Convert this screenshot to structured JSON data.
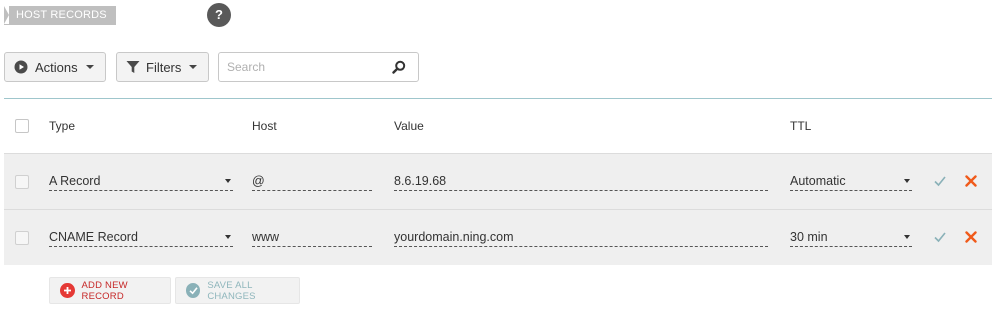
{
  "section_title": "HOST RECORDS",
  "help_label": "?",
  "toolbar": {
    "actions_label": "Actions",
    "filters_label": "Filters",
    "search_placeholder": "Search"
  },
  "table": {
    "headers": {
      "type": "Type",
      "host": "Host",
      "value": "Value",
      "ttl": "TTL"
    },
    "rows": [
      {
        "type": "A Record",
        "host": "@",
        "value": "8.6.19.68",
        "ttl": "Automatic"
      },
      {
        "type": "CNAME Record",
        "host": "www",
        "value": "yourdomain.ning.com",
        "ttl": "30 min"
      }
    ]
  },
  "buttons": {
    "add_label": "ADD NEW RECORD",
    "save_label": "SAVE ALL CHANGES"
  },
  "colors": {
    "accent_teal": "#8ab1b8",
    "danger": "#e53935",
    "delete_x": "#f05a1a"
  }
}
